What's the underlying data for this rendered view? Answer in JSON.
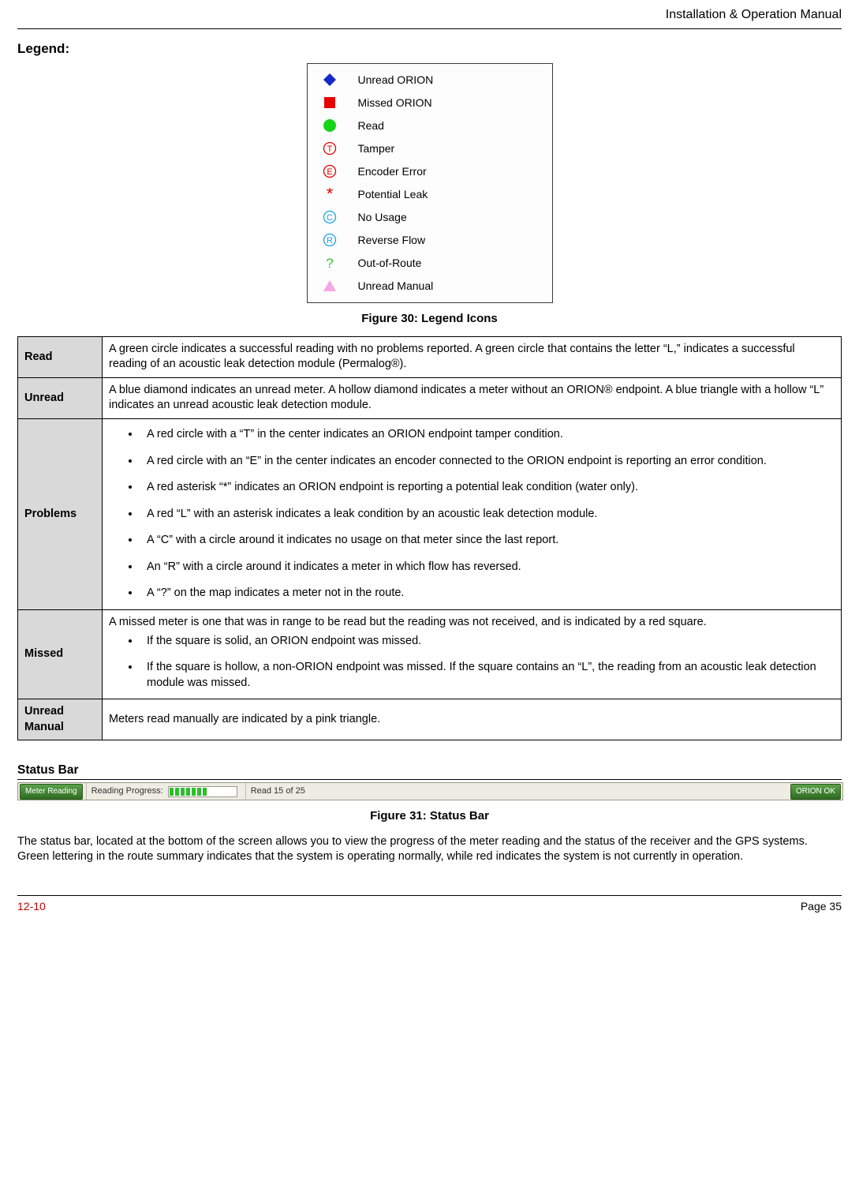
{
  "header": {
    "title": "Installation & Operation Manual"
  },
  "legend_heading": "Legend:",
  "legend_items": [
    {
      "icon": "blue-diamond",
      "label": "Unread ORION"
    },
    {
      "icon": "red-square",
      "label": "Missed ORION"
    },
    {
      "icon": "green-circle",
      "label": "Read"
    },
    {
      "icon": "letter-T",
      "label": "Tamper"
    },
    {
      "icon": "letter-E",
      "label": "Encoder Error"
    },
    {
      "icon": "asterisk",
      "label": "Potential Leak"
    },
    {
      "icon": "letter-C",
      "label": "No Usage"
    },
    {
      "icon": "letter-R",
      "label": "Reverse Flow"
    },
    {
      "icon": "question",
      "label": "Out-of-Route"
    },
    {
      "icon": "pink-triangle",
      "label": "Unread Manual"
    }
  ],
  "figure30_caption": "Figure 30: Legend Icons",
  "table": {
    "rows": [
      {
        "label": "Read",
        "desc": "A green circle indicates a successful reading with no problems reported.  A green circle that contains the letter “L,” indicates a successful reading of an acoustic leak detection module (Permalog®)."
      },
      {
        "label": "Unread",
        "desc": "A blue diamond indicates an unread meter.  A hollow diamond indicates a meter without an ORION® endpoint.    A blue triangle with a hollow “L” indicates an unread acoustic leak detection module."
      },
      {
        "label": "Problems",
        "bullets": [
          "A red circle with a “T” in the center indicates an ORION endpoint tamper condition.",
          " A red circle with an “E” in the center indicates an encoder connected to the ORION endpoint is reporting an error condition.",
          "A red asterisk “*” indicates an ORION endpoint is reporting a potential leak condition (water only).",
          "A red “L” with an asterisk indicates a leak condition by an acoustic leak detection module.",
          "A “C” with a circle around it indicates no usage on that meter since the last report.",
          "An “R” with a circle around it indicates a meter in which flow has reversed.",
          "A “?” on the map indicates a meter not in the route."
        ]
      },
      {
        "label": "Missed",
        "desc": "A missed meter is one that was in range to be read but the reading was not received, and is indicated by a red square.",
        "bullets": [
          "If the square is solid, an ORION endpoint was missed.",
          "If the square is hollow, a non-ORION endpoint was missed.  If the square contains an “L”, the reading from an acoustic leak detection module was missed."
        ]
      },
      {
        "label": "Unread Manual",
        "desc": "Meters read manually are indicated by a pink triangle."
      }
    ]
  },
  "status_bar_heading": " Status Bar",
  "status_bar": {
    "meter_reading": "Meter Reading",
    "progress_label": "Reading Progress:",
    "progress_text": "Read 15 of 25",
    "orion_ok": "ORION OK"
  },
  "figure31_caption": "Figure 31:  Status Bar",
  "status_para": "The status bar, located at the bottom of the screen allows you to view the progress of the meter reading and the status of the receiver and the GPS systems.  Green lettering in the route summary indicates that the system is operating normally, while red indicates the system is not currently in operation.",
  "footer": {
    "left": "12-10",
    "right": "Page 35"
  }
}
